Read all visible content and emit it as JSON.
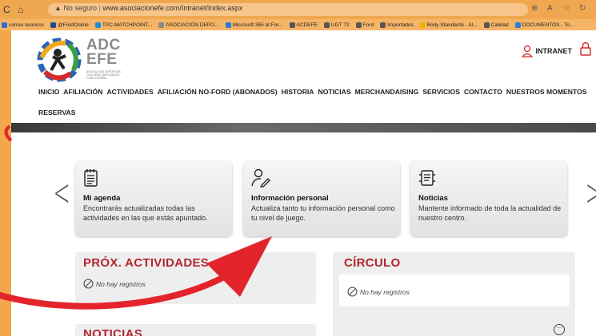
{
  "browser": {
    "security": "No seguro",
    "url": "www.asociacionefe.com/Intranet/Index.aspx"
  },
  "bookmarks": [
    {
      "label": "correo tecnicos",
      "color": "#2a6fd6"
    },
    {
      "label": "@FordOnline",
      "color": "#1a4b8c"
    },
    {
      "label": "TPC-MATCHPOINT...",
      "color": "#1e88e5"
    },
    {
      "label": "ASOCIACIÓN DEPO...",
      "color": "#888888"
    },
    {
      "label": "Microsoft 365 at For...",
      "color": "#2b7cd3"
    },
    {
      "label": "ACDEFE",
      "color": "#555555"
    },
    {
      "label": "UGT T2",
      "color": "#555555"
    },
    {
      "label": "Ford",
      "color": "#555555"
    },
    {
      "label": "Importados",
      "color": "#555555"
    },
    {
      "label": "Body Standards - Al...",
      "color": "#f0b400"
    },
    {
      "label": "Calidad",
      "color": "#555555"
    },
    {
      "label": "DOCUMENTOS - To...",
      "color": "#2b7cd3"
    }
  ],
  "header": {
    "logo_line1": "ADC",
    "logo_line2": "EFE",
    "logo_sub": "ASOCIACIÓN DEPORTIVA CULTURAL EMPLEADOS FORD ESPAÑA",
    "intranet_label": "INTRANET"
  },
  "menu": {
    "items": [
      "INICIO",
      "AFILIACIÓN",
      "ACTIVIDADES",
      "AFILIACIÓN NO-FORD (ABONADOS)",
      "HISTORIA",
      "NOTICIAS",
      "MERCHANDAISING",
      "SERVICIOS",
      "CONTACTO",
      "NUESTROS MOMENTOS"
    ],
    "second_row": "RESERVAS"
  },
  "cards": [
    {
      "title": "Mi agenda",
      "desc": "Encontrarás actualizadas todas las actividades en las que estás apuntado.",
      "icon": "agenda-icon"
    },
    {
      "title": "Información personal",
      "desc": "Actualiza tanto tu información personal como tu nivel de juego.",
      "icon": "person-edit-icon"
    },
    {
      "title": "Noticias",
      "desc": "Mantente informado de toda la actualidad de nuestro centro.",
      "icon": "news-icon"
    }
  ],
  "panels": {
    "activities_title": "PRÓX. ACTIVIDADES",
    "activities_empty": "No hay registros",
    "circle_title": "CÍRCULO",
    "circle_empty": "No hay registros",
    "news_title": "NOTICIAS"
  },
  "colors": {
    "accent_red": "#b3262f",
    "arrow_red": "#e3242b",
    "background_orange": "#f3a64a"
  }
}
